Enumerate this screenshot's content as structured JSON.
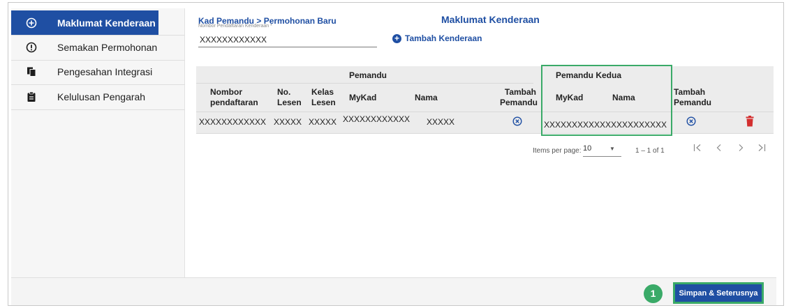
{
  "sidebar": {
    "items": [
      {
        "label": "Maklumat Kenderaan",
        "icon": "plus-circle-icon",
        "active": true
      },
      {
        "label": "Semakan Permohonan",
        "icon": "alert-circle-icon",
        "active": false
      },
      {
        "label": "Pengesahan Integrasi",
        "icon": "copy-pages-icon",
        "active": false
      },
      {
        "label": "Kelulusan Pengarah",
        "icon": "clipboard-icon",
        "active": false
      }
    ]
  },
  "header": {
    "breadcrumb": "Kad Pemandu > Permohonan Baru",
    "title": "Maklumat Kenderaan",
    "field_label": "Nombor Pendaftaran Kenderaan *",
    "field_value": "XXXXXXXXXXXX",
    "add_vehicle_label": "Tambah Kenderaan"
  },
  "table": {
    "group_pemandu": "Pemandu",
    "group_pemandu_kedua": "Pemandu Kedua",
    "columns": {
      "nombor_1": "Nombor",
      "nombor_2": "pendaftaran",
      "no_1": "No.",
      "no_2": "Lesen",
      "kelas_1": "Kelas",
      "kelas_2": "Lesen",
      "mykad": "MyKad",
      "nama": "Nama",
      "tambah1_1": "Tambah",
      "tambah1_2": "Pemandu",
      "mykad2": "MyKad",
      "nama2": "Nama",
      "tambah2_1": "Tambah",
      "tambah2_2": "Pemandu"
    },
    "rows": [
      {
        "nombor_pendaftaran": "XXXXXXXXXXXX",
        "no_lesen": "XXXXX",
        "kelas_lesen": "XXXXX",
        "mykad": "XXXXXXXXXXXX",
        "nama": "XXXXX",
        "mykad2": "XXXXXXXXXXXX",
        "nama2": "XXXXXXXXXX"
      }
    ]
  },
  "pager": {
    "items_per_page_label": "Items per page:",
    "items_per_page_value": "10",
    "range": "1 – 1 of 1"
  },
  "footer": {
    "step_number": "1",
    "save_label": "Simpan & Seterusnya"
  },
  "colors": {
    "primary": "#1f4fa3",
    "highlight": "#3aaa68",
    "delete": "#d32f2f"
  }
}
